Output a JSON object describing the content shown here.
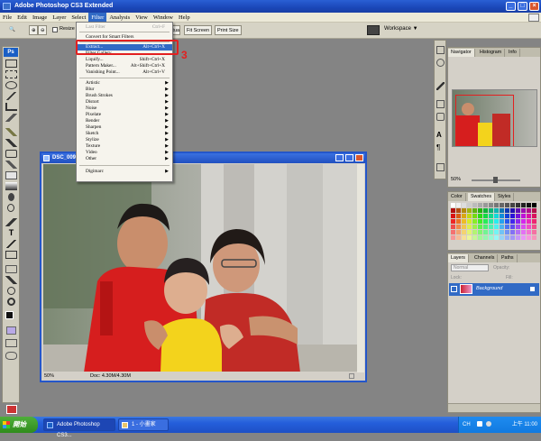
{
  "window": {
    "title": "Adobe Photoshop CS3 Extended",
    "controls": [
      "_",
      "□",
      "×"
    ]
  },
  "menubar": {
    "items": [
      "File",
      "Edit",
      "Image",
      "Layer",
      "Select",
      "Filter",
      "Analysis",
      "View",
      "Window",
      "Help"
    ],
    "active": "Filter"
  },
  "options": {
    "zoom_buttons": [
      "🔍",
      "⊕",
      "⊖"
    ],
    "resize_windows": "Resize Windows To Fit",
    "actual_pixels": "Actual Pixels",
    "fit_screen": "Fit Screen",
    "print_size": "Print Size",
    "workspace": "Workspace ▼"
  },
  "filter_menu": {
    "items": [
      {
        "label": "Last Filter",
        "shortcut": "Ctrl+F",
        "disabled": true
      },
      {
        "label": "Convert for Smart Filters",
        "shortcut": "",
        "disabled": false
      },
      {
        "label": "Extract...",
        "shortcut": "Alt+Ctrl+X",
        "highlighted": true
      },
      {
        "label": "Filter Gallery...",
        "shortcut": ""
      },
      {
        "label": "Liquify...",
        "shortcut": "Shift+Ctrl+X"
      },
      {
        "label": "Pattern Maker...",
        "shortcut": "Alt+Shift+Ctrl+X"
      },
      {
        "label": "Vanishing Point...",
        "shortcut": "Alt+Ctrl+V"
      },
      {
        "label": "Artistic",
        "submenu": true
      },
      {
        "label": "Blur",
        "submenu": true
      },
      {
        "label": "Brush Strokes",
        "submenu": true
      },
      {
        "label": "Distort",
        "submenu": true
      },
      {
        "label": "Noise",
        "submenu": true
      },
      {
        "label": "Pixelate",
        "submenu": true
      },
      {
        "label": "Render",
        "submenu": true
      },
      {
        "label": "Sharpen",
        "submenu": true
      },
      {
        "label": "Sketch",
        "submenu": true
      },
      {
        "label": "Stylize",
        "submenu": true
      },
      {
        "label": "Texture",
        "submenu": true
      },
      {
        "label": "Video",
        "submenu": true
      },
      {
        "label": "Other",
        "submenu": true
      },
      {
        "label": "Digimarc",
        "submenu": true
      }
    ],
    "step_number": "3"
  },
  "document": {
    "title": "DSC_0092",
    "zoom": "50%",
    "doc_info": "Doc: 4.30M/4.30M"
  },
  "navigator": {
    "tabs": [
      "Navigator",
      "Histogram",
      "Info"
    ],
    "zoom": "50%"
  },
  "color_panel": {
    "tabs": [
      "Color",
      "Swatches",
      "Styles"
    ]
  },
  "layers_panel": {
    "tabs": [
      "Layers",
      "Channels",
      "Paths"
    ],
    "blend_mode": "Normal",
    "opacity_label": "Opacity:",
    "lock_label": "Lock:",
    "fill_label": "Fill:",
    "layer_name": "Background"
  },
  "taskbar": {
    "start_label": "開始",
    "tasks": [
      "Adobe Photoshop CS3...",
      "1 - 小畫家"
    ],
    "tray_lang": "CH",
    "clock": "上午 11:00"
  },
  "colors": {
    "accent": "#316ac5",
    "highlight_box": "#e22020"
  }
}
